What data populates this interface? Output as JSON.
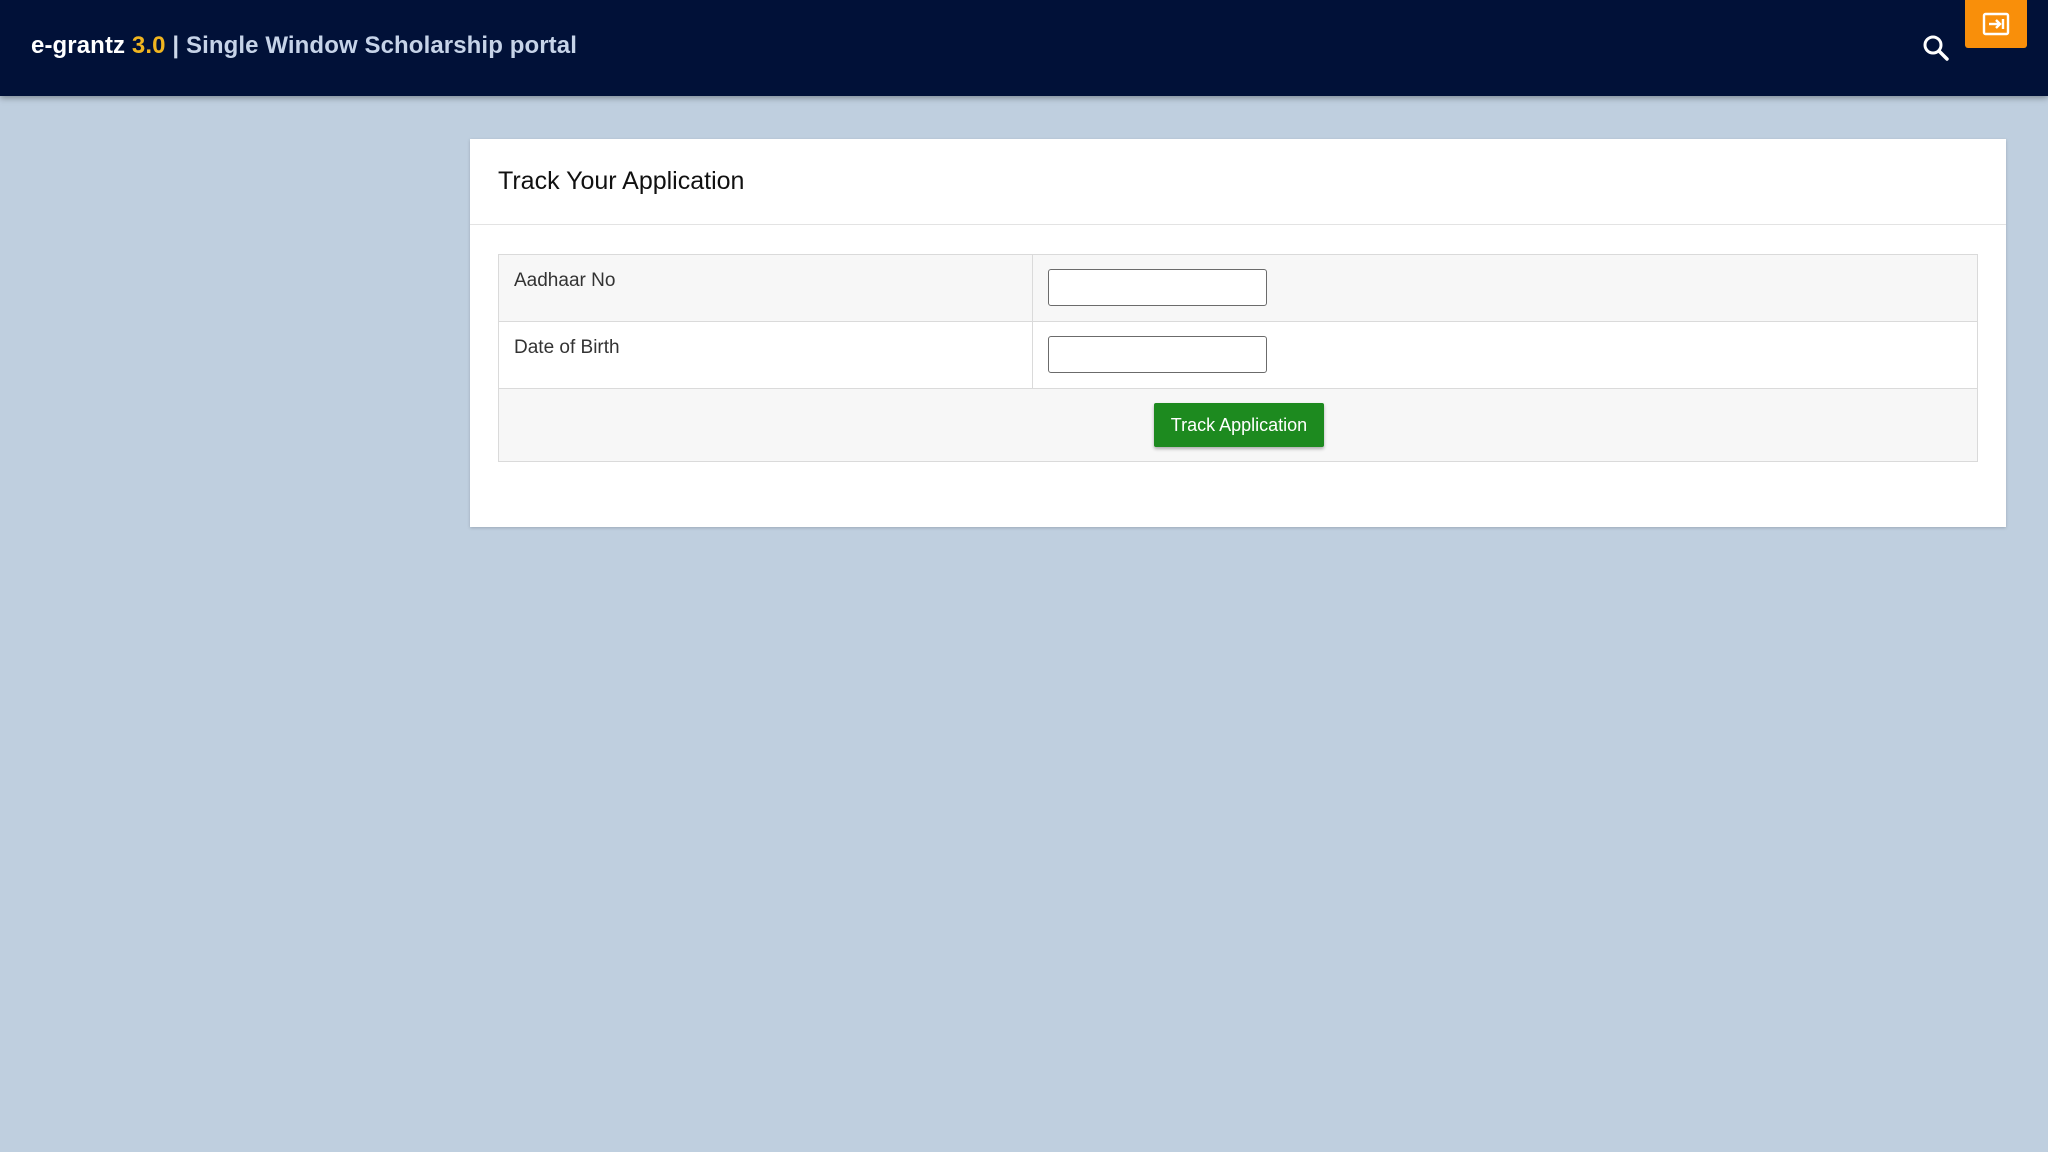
{
  "header": {
    "app_name": "e-grantz",
    "version": "3.0",
    "separator": "|",
    "subtitle": "Single Window Scholarship portal",
    "search_icon": "search-icon",
    "logout_icon": "logout-icon",
    "colors": {
      "bar": "#011138",
      "version": "#f0b520",
      "logout_button": "#f98f0a"
    }
  },
  "card": {
    "title": "Track Your Application",
    "fields": [
      {
        "label": "Aadhaar No",
        "value": "",
        "placeholder": ""
      },
      {
        "label": "Date of Birth",
        "value": "",
        "placeholder": ""
      }
    ],
    "submit_label": "Track Application",
    "colors": {
      "submit_button": "#1d8a1f"
    }
  },
  "page": {
    "background": "#bfcfdf"
  }
}
